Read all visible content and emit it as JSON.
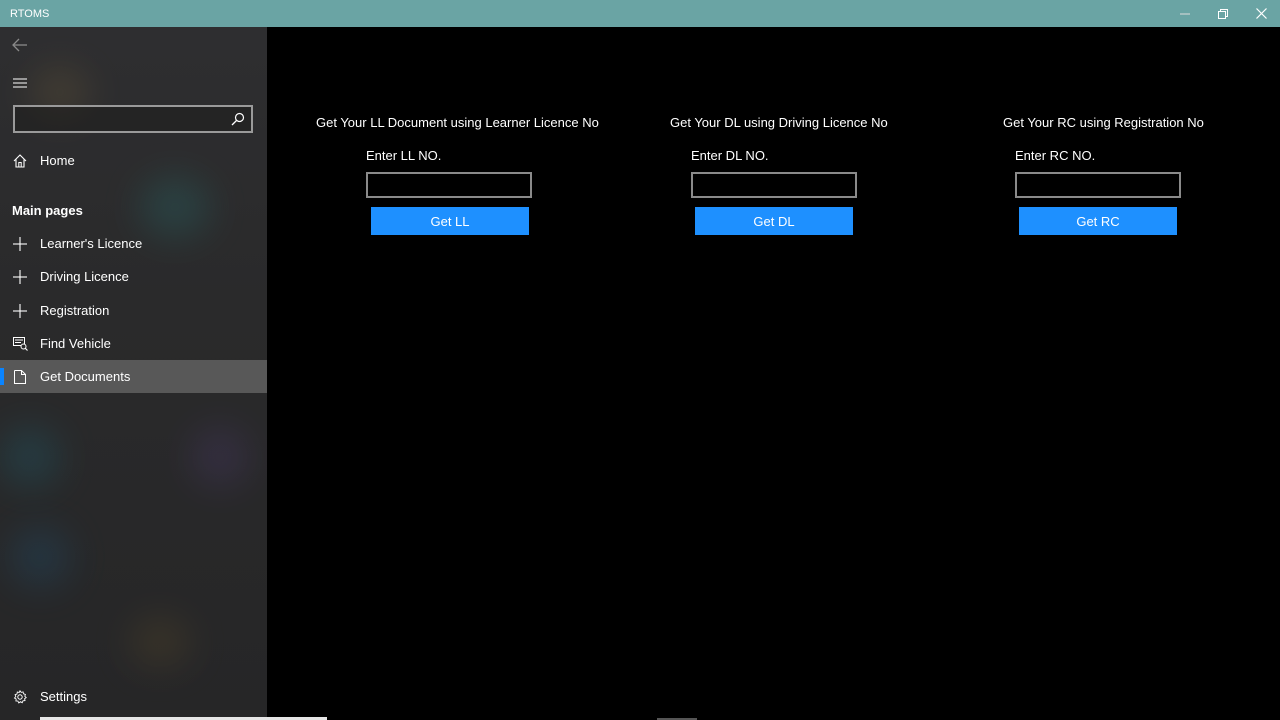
{
  "window": {
    "title": "RTOMS",
    "minimize_icon": "minimize-icon",
    "restore_icon": "restore-icon",
    "close_icon": "close-icon",
    "titlebar_color": "#6aa4a4"
  },
  "sidebar": {
    "search": {
      "value": "",
      "placeholder": ""
    },
    "home_label": "Home",
    "section_header": "Main pages",
    "items": [
      {
        "label": "Learner's Licence",
        "icon": "plus-icon"
      },
      {
        "label": "Driving Licence",
        "icon": "plus-icon"
      },
      {
        "label": "Registration",
        "icon": "plus-icon"
      },
      {
        "label": "Find Vehicle",
        "icon": "vehicle-search-icon"
      },
      {
        "label": "Get Documents",
        "icon": "document-icon",
        "selected": true
      }
    ],
    "settings_label": "Settings",
    "accent_color": "#0a84ff"
  },
  "main": {
    "panels": [
      {
        "heading": "Get Your LL Document using Learner Licence No",
        "label": "Enter LL NO.",
        "input_value": "",
        "button": "Get LL"
      },
      {
        "heading": "Get Your DL using Driving Licence No",
        "label": "Enter DL NO.",
        "input_value": "",
        "button": "Get DL"
      },
      {
        "heading": "Get Your RC using Registration No",
        "label": "Enter RC NO.",
        "input_value": "",
        "button": "Get RC"
      }
    ],
    "button_color": "#1e90ff"
  }
}
